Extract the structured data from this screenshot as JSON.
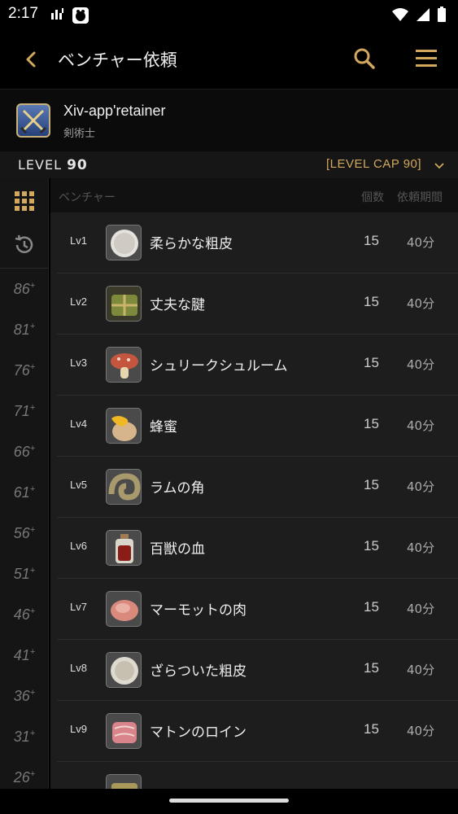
{
  "status": {
    "time": "2:17",
    "left_icons": [
      "signal-bars-icon",
      "app-notification-icon"
    ],
    "right_icons": [
      "wifi-icon",
      "cell-signal-icon",
      "battery-icon"
    ]
  },
  "appbar": {
    "title": "ベンチャー依頼",
    "back_icon": "back-arrow-icon",
    "search_icon": "search-icon",
    "menu_icon": "hamburger-menu-icon",
    "accent": "#d1a85e"
  },
  "character": {
    "name": "Xiv-app'retainer",
    "job": "剣術士"
  },
  "levelbar": {
    "level_label": "LEVEL",
    "level_value": "90",
    "cap": "[LEVEL CAP 90]"
  },
  "sidebar": {
    "grid_icon": "grid-icon",
    "history_icon": "history-icon",
    "levels": [
      "86",
      "81",
      "76",
      "71",
      "66",
      "61",
      "56",
      "51",
      "46",
      "41",
      "36",
      "31",
      "26"
    ],
    "plus": "+"
  },
  "list": {
    "headers": {
      "venture": "ベンチャー",
      "count": "個数",
      "duration": "依頼期間"
    },
    "items": [
      {
        "lv": "Lv1",
        "name": "柔らかな粗皮",
        "qty": "15",
        "dur": "40分",
        "icon": "soft-hide-icon"
      },
      {
        "lv": "Lv2",
        "name": "丈夫な腱",
        "qty": "15",
        "dur": "40分",
        "icon": "sinew-bundle-icon"
      },
      {
        "lv": "Lv3",
        "name": "シュリークシュルーム",
        "qty": "15",
        "dur": "40分",
        "icon": "mushroom-icon"
      },
      {
        "lv": "Lv4",
        "name": "蜂蜜",
        "qty": "15",
        "dur": "40分",
        "icon": "honey-jar-icon"
      },
      {
        "lv": "Lv5",
        "name": "ラムの角",
        "qty": "15",
        "dur": "40分",
        "icon": "ram-horn-icon"
      },
      {
        "lv": "Lv6",
        "name": "百獣の血",
        "qty": "15",
        "dur": "40分",
        "icon": "blood-vial-icon"
      },
      {
        "lv": "Lv7",
        "name": "マーモットの肉",
        "qty": "15",
        "dur": "40分",
        "icon": "meat-icon"
      },
      {
        "lv": "Lv8",
        "name": "ざらついた粗皮",
        "qty": "15",
        "dur": "40分",
        "icon": "rough-hide-icon"
      },
      {
        "lv": "Lv9",
        "name": "マトンのロイン",
        "qty": "15",
        "dur": "40分",
        "icon": "mutton-loin-icon"
      },
      {
        "lv": "",
        "name": "",
        "qty": "",
        "dur": "",
        "icon": "partial-item-icon"
      }
    ]
  }
}
